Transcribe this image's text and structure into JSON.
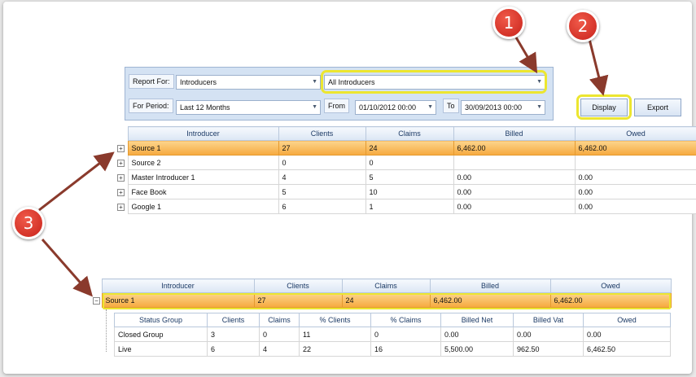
{
  "filters": {
    "report_for_label": "Report For:",
    "report_for_value": "Introducers",
    "report_for_detail_value": "All Introducers",
    "for_period_label": "For Period:",
    "for_period_value": "Last 12 Months",
    "from_label": "From",
    "from_value": "01/10/2012 00:00",
    "to_label": "To",
    "to_value": "30/09/2013 00:00"
  },
  "buttons": {
    "display": "Display",
    "export": "Export"
  },
  "main_grid": {
    "columns": [
      "Introducer",
      "Clients",
      "Claims",
      "Billed",
      "Owed"
    ],
    "rows": [
      {
        "introducer": "Source 1",
        "clients": "27",
        "claims": "24",
        "billed": "6,462.00",
        "owed": "6,462.00",
        "selected": true
      },
      {
        "introducer": "Source 2",
        "clients": "0",
        "claims": "0",
        "billed": "",
        "owed": ""
      },
      {
        "introducer": "Master Introducer 1",
        "clients": "4",
        "claims": "5",
        "billed": "0.00",
        "owed": "0.00"
      },
      {
        "introducer": "Face Book",
        "clients": "5",
        "claims": "10",
        "billed": "0.00",
        "owed": "0.00"
      },
      {
        "introducer": "Google 1",
        "clients": "6",
        "claims": "1",
        "billed": "0.00",
        "owed": "0.00"
      }
    ]
  },
  "expanded_grid": {
    "columns": [
      "Introducer",
      "Clients",
      "Claims",
      "Billed",
      "Owed"
    ],
    "row": {
      "introducer": "Source 1",
      "clients": "27",
      "claims": "24",
      "billed": "6,462.00",
      "owed": "6,462.00"
    },
    "sub_columns": [
      "Status Group",
      "Clients",
      "Claims",
      "% Clients",
      "% Claims",
      "Billed Net",
      "Billed Vat",
      "Owed"
    ],
    "sub_rows": [
      {
        "status_group": "Closed Group",
        "clients": "3",
        "claims": "0",
        "pct_clients": "11",
        "pct_claims": "0",
        "billed_net": "0.00",
        "billed_vat": "0.00",
        "owed": "0.00"
      },
      {
        "status_group": "Live",
        "clients": "6",
        "claims": "4",
        "pct_clients": "22",
        "pct_claims": "16",
        "billed_net": "5,500.00",
        "billed_vat": "962.50",
        "owed": "6,462.50"
      }
    ]
  },
  "annotations": {
    "badge_1": "1",
    "badge_2": "2",
    "badge_3": "3"
  },
  "icons": {
    "dropdown": "chevron-down-icon",
    "expand": "plus-box-icon",
    "collapse": "minus-box-icon"
  },
  "colors": {
    "highlight": "#ece630",
    "badge": "#d9302a",
    "selected_row": "#f8b34c",
    "arrow": "#8a3a2c"
  }
}
